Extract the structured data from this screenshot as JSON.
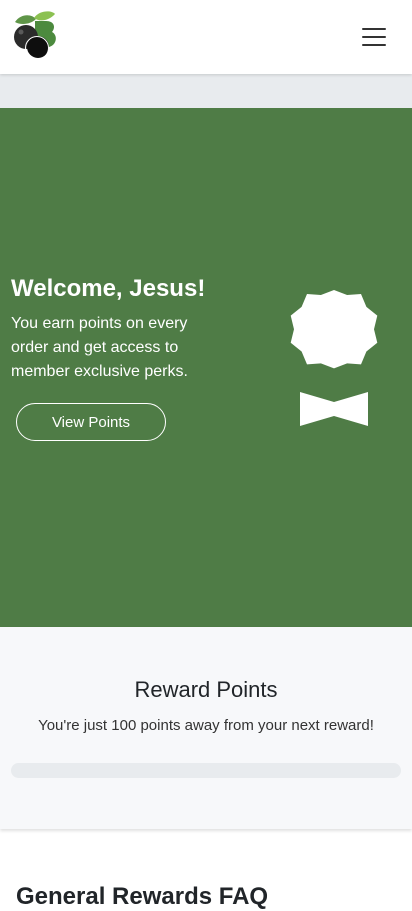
{
  "header": {
    "logo_icon": "blueberry-leaf-logo-icon",
    "menu_icon": "hamburger-menu-icon"
  },
  "hero": {
    "title": "Welcome, Jesus!",
    "text": "You earn points on every order and get access to member exclusive perks.",
    "button_label": "View Points",
    "award_icon": "award-ribbon-icon",
    "background_color": "#4f7c46"
  },
  "points": {
    "title": "Reward Points",
    "subtitle": "You're just 100 points away from your next reward!",
    "progress_fraction": 0
  },
  "faq": {
    "title": "General Rewards FAQ"
  }
}
